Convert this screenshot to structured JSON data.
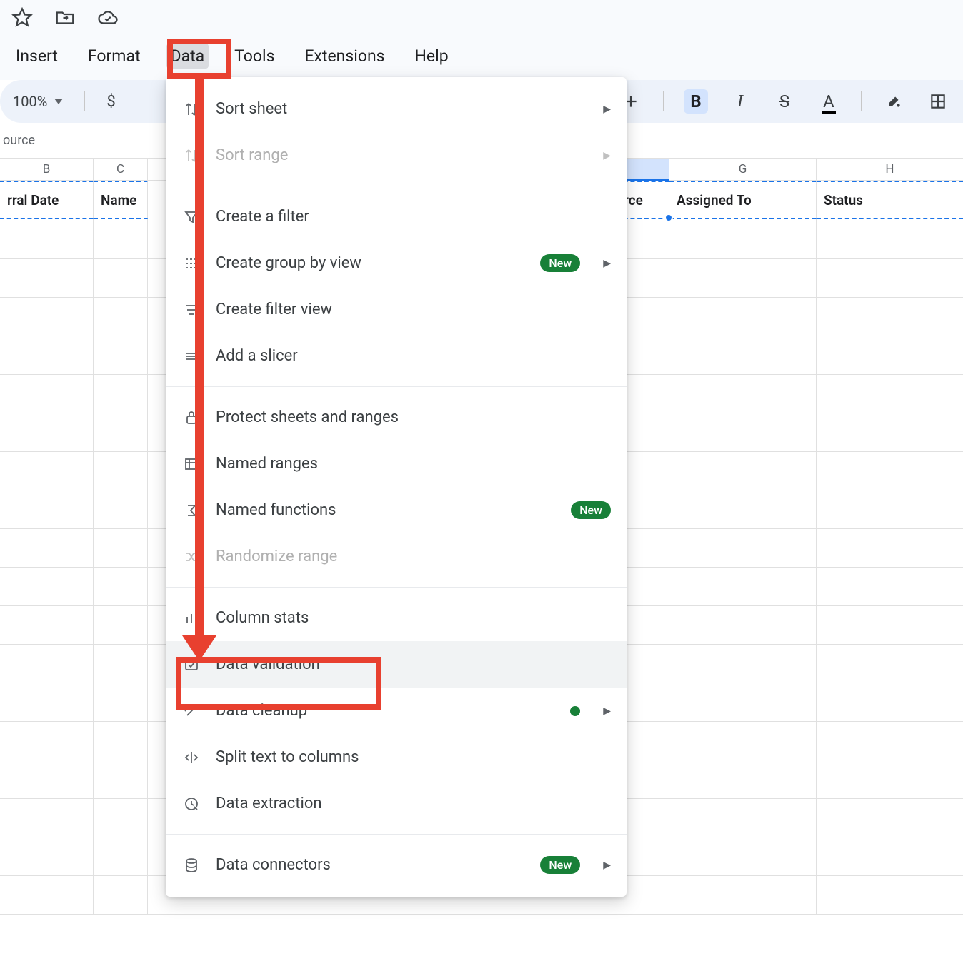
{
  "menubar": {
    "insert": "Insert",
    "format": "Format",
    "data": "Data",
    "tools": "Tools",
    "extensions": "Extensions",
    "help": "Help"
  },
  "toolbar": {
    "zoom": "100%",
    "currency": "$",
    "bold": "B",
    "italic": "I",
    "strike": "S",
    "textcolor_letter": "A"
  },
  "formula_bar": {
    "label": "ource"
  },
  "columns": {
    "B": "B",
    "C": "C",
    "F_partial": "rce",
    "G": "G",
    "H": "H"
  },
  "header_row": {
    "B": "rral Date",
    "C": "Name",
    "G": "Assigned To",
    "H": "Status"
  },
  "dropdown": {
    "sort_sheet": "Sort sheet",
    "sort_range": "Sort range",
    "create_filter": "Create a filter",
    "create_group_by_view": "Create group by view",
    "create_filter_view": "Create filter view",
    "add_slicer": "Add a slicer",
    "protect": "Protect sheets and ranges",
    "named_ranges": "Named ranges",
    "named_functions": "Named functions",
    "randomize_range": "Randomize range",
    "column_stats": "Column stats",
    "data_validation": "Data validation",
    "data_cleanup": "Data cleanup",
    "split_text": "Split text to columns",
    "data_extraction": "Data extraction",
    "data_connectors": "Data connectors",
    "new_badge": "New"
  }
}
